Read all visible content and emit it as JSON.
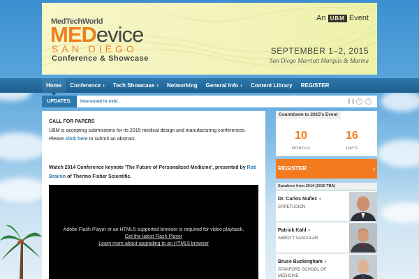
{
  "header": {
    "logo_small": "MedTechWorld",
    "logo_med": "MED",
    "logo_device": "evice",
    "logo_city": "SAN DIEGO",
    "logo_sub": "Conference & Showcase",
    "tag_prefix": "An",
    "tag_brand": "UBM",
    "tag_suffix": "Event",
    "date": "SEPTEMBER 1–2, 2015",
    "venue": "San Diego Marriott Marquis & Marina"
  },
  "nav": {
    "items": [
      {
        "label": "Home",
        "has_chevron": false,
        "active": true
      },
      {
        "label": "Conference",
        "has_chevron": true
      },
      {
        "label": "Tech Showcase",
        "has_chevron": true
      },
      {
        "label": "Networking",
        "has_chevron": false
      },
      {
        "label": "General Info",
        "has_chevron": true
      },
      {
        "label": "Content Library",
        "has_chevron": false
      },
      {
        "label": "REGISTER",
        "has_chevron": false
      }
    ],
    "chevron": "›"
  },
  "updates": {
    "label": "UPDATES:",
    "text": "Interested in exhi_"
  },
  "main": {
    "cfp_title": "CALL FOR PAPERS",
    "cfp_text_1": "UBM is accepting submissions for its 2015 medical design and manufacturing conferences. Please ",
    "cfp_link": "click here",
    "cfp_text_2": " to submit an abstract.",
    "keynote_1": "Watch 2014 Conference keynote 'The Future of Personalized Medicine', presented by ",
    "keynote_link": "Rob Brainin",
    "keynote_2": " of Thermo Fisher Scientific.",
    "video_msg": "Adobe Flash Player or an HTML5 supported browser is required for video playback.",
    "video_link_1": "Get the latest Flash Player",
    "video_link_2": "Learn more about upgrading to an HTML5 browser"
  },
  "countdown": {
    "title": "Countdown to 2015's Event",
    "months_value": "10",
    "months_label": "MONTHS",
    "days_value": "16",
    "days_label": "DAYS"
  },
  "register": {
    "label": "REGISTER",
    "chevron": "›"
  },
  "speakers": {
    "title": "Speakers from 2014 (2015 TBA)",
    "items": [
      {
        "name": "Dr. Carlos Nuñez",
        "org": "CAREFUSION"
      },
      {
        "name": "Patrick Kahl",
        "org": "ABBOTT VASCULAR"
      },
      {
        "name": "Bruce Buckingham",
        "org": "STANFORD SCHOOL OF MEDICINE"
      }
    ]
  },
  "colors": {
    "accent_orange": "#f07f1e",
    "nav_blue": "#2c79ad",
    "register_orange": "#f47a20"
  }
}
